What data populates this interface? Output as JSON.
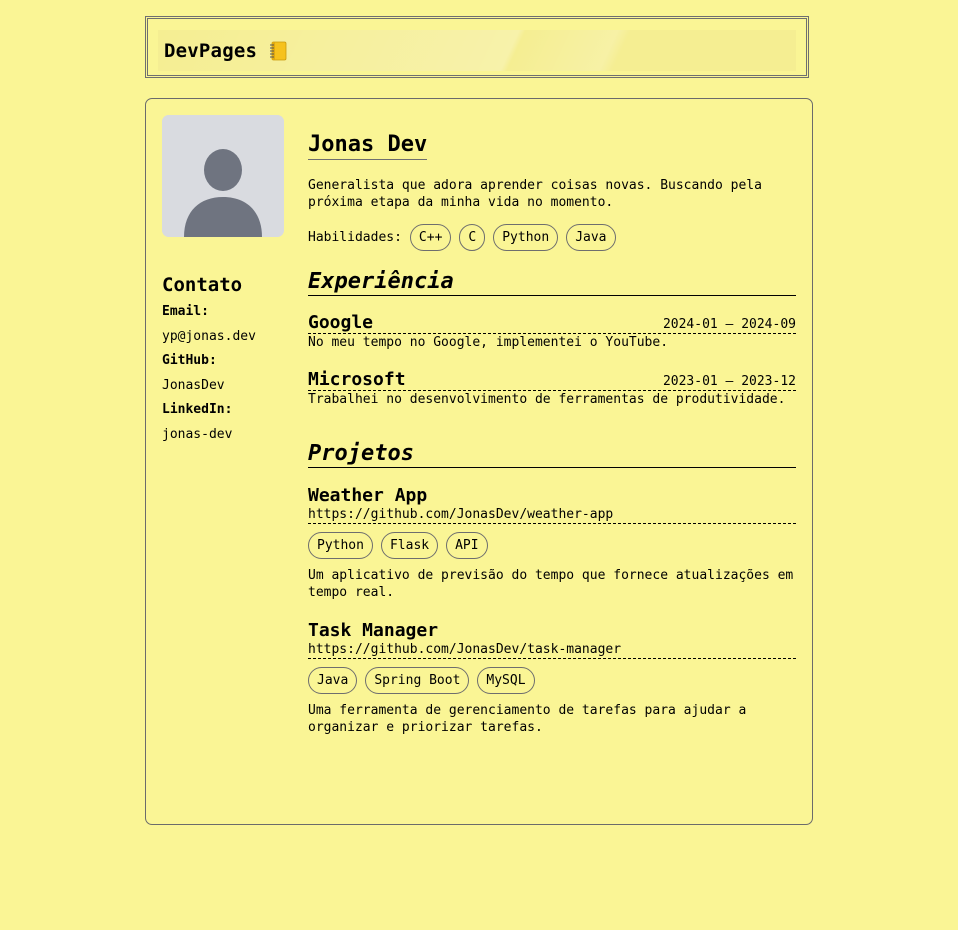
{
  "header": {
    "brand": "DevPages",
    "icon": "notebook-icon"
  },
  "sidebar": {
    "avatar_icon": "user-avatar-placeholder",
    "contact_title": "Contato",
    "email_label": "Email:",
    "email_value": "yp@jonas.dev",
    "github_label": "GitHub:",
    "github_value": "JonasDev",
    "linkedin_label": "LinkedIn:",
    "linkedin_value": "jonas-dev"
  },
  "profile": {
    "name": "Jonas Dev",
    "bio": "Generalista que adora aprender coisas novas. Buscando pela próxima etapa da minha vida no momento.",
    "skills_label": "Habilidades:",
    "skills": [
      "C++",
      "C",
      "Python",
      "Java"
    ]
  },
  "experience": {
    "title": "Experiência",
    "items": [
      {
        "company": "Google",
        "dates": "2024-01 – 2024-09",
        "description": "No meu tempo no Google, implementei o YouTube."
      },
      {
        "company": "Microsoft",
        "dates": "2023-01 – 2023-12",
        "description": "Trabalhei no desenvolvimento de ferramentas de produtividade."
      }
    ]
  },
  "projects": {
    "title": "Projetos",
    "items": [
      {
        "name": "Weather App",
        "link": "https://github.com/JonasDev/weather-app",
        "tags": [
          "Python",
          "Flask",
          "API"
        ],
        "description": "Um aplicativo de previsão do tempo que fornece atualizações em tempo real."
      },
      {
        "name": "Task Manager",
        "link": "https://github.com/JonasDev/task-manager",
        "tags": [
          "Java",
          "Spring Boot",
          "MySQL"
        ],
        "description": "Uma ferramenta de gerenciamento de tarefas para ajudar a organizar e priorizar tarefas."
      }
    ]
  },
  "colors": {
    "background": "#faf595",
    "avatar_bg": "#d9dbe0",
    "avatar_figure": "#6f7480",
    "border": "#6e6e6e"
  }
}
